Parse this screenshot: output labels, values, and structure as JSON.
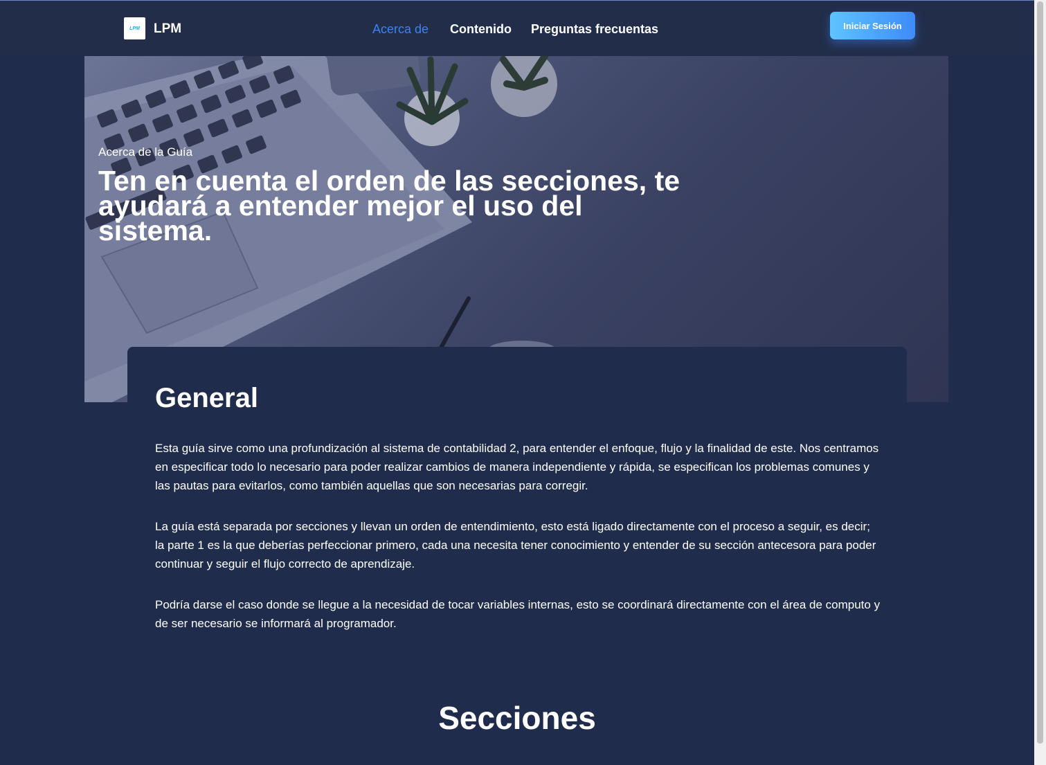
{
  "nav": {
    "logo_text": "LPM",
    "brand": "LPM",
    "links": [
      {
        "label": "Acerca de",
        "active": true
      },
      {
        "label": "Contenido",
        "active": false
      },
      {
        "label": "Preguntas frecuentas",
        "active": false
      }
    ],
    "login_label": "Iniciar Sesión"
  },
  "hero": {
    "eyebrow": "Acerca de la Guía",
    "title": "Ten en cuenta el orden de las secciones, te ayudará a entender mejor el uso del sistema."
  },
  "general": {
    "heading": "General",
    "paragraphs": [
      "Esta guía sirve como una profundización al sistema de contabilidad 2, para entender el enfoque, flujo y la finalidad de este. Nos centramos en especificar todo lo necesario para poder realizar cambios de manera independiente y rápida, se especifican los problemas comunes y las pautas para evitarlos, como también aquellas que son necesarias para corregir.",
      "La guía está separada por secciones y llevan un orden de entendimiento, esto está ligado directamente con el proceso a seguir, es decir; la parte 1 es la que deberías perfeccionar primero, cada una necesita tener conocimiento y entender de su sección antecesora para poder continuar y seguir el flujo correcto de aprendizaje.",
      "Podría darse el caso donde se llegue a la necesidad de tocar variables internas, esto se coordinará directamente con el área de computo y de ser necesario se informará al programador."
    ]
  },
  "sections": {
    "heading": "Secciones"
  },
  "colors": {
    "background": "#202c4b",
    "navbar": "#222d49",
    "accent": "#3b82f6",
    "button_gradient_start": "#5ec4ff",
    "button_gradient_end": "#3e8bf7"
  }
}
